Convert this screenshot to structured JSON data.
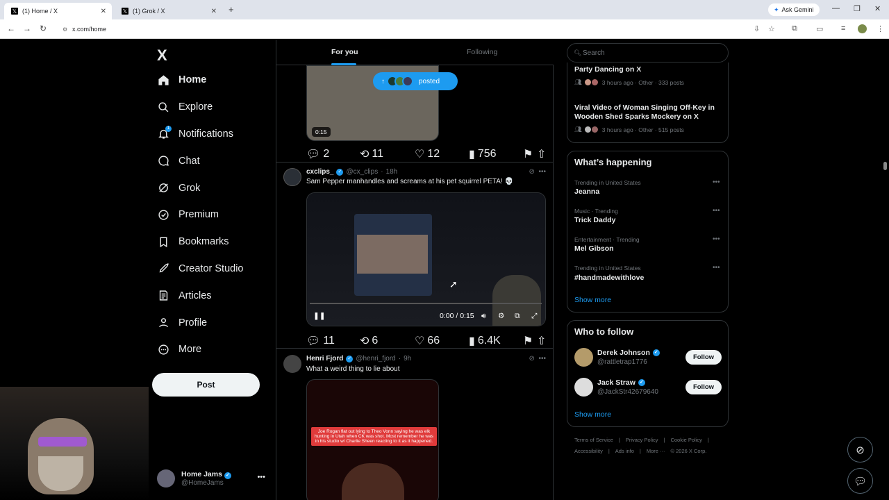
{
  "browser": {
    "tabs": [
      {
        "title": "(1) Home / X",
        "active": true
      },
      {
        "title": "(1) Grok / X",
        "active": false
      }
    ],
    "ask_gemini": "Ask Gemini",
    "url": "x.com/home"
  },
  "sidebar": {
    "logo": "X",
    "items": [
      {
        "label": "Home",
        "icon": "home-icon"
      },
      {
        "label": "Explore",
        "icon": "search-icon"
      },
      {
        "label": "Notifications",
        "icon": "bell-icon",
        "badge": "1"
      },
      {
        "label": "Chat",
        "icon": "chat-icon"
      },
      {
        "label": "Grok",
        "icon": "grok-icon"
      },
      {
        "label": "Premium",
        "icon": "premium-icon"
      },
      {
        "label": "Bookmarks",
        "icon": "bookmark-icon"
      },
      {
        "label": "Creator Studio",
        "icon": "rocket-icon"
      },
      {
        "label": "Articles",
        "icon": "article-icon"
      },
      {
        "label": "Profile",
        "icon": "profile-icon"
      },
      {
        "label": "More",
        "icon": "more-circle-icon"
      }
    ],
    "post_button": "Post",
    "account": {
      "name": "Home Jams",
      "handle": "@HomeJams"
    }
  },
  "feed": {
    "tabs": [
      "For you",
      "Following"
    ],
    "new_posts_pill": "posted",
    "posts": [
      {
        "media_time": "0:15",
        "replies": "2",
        "reposts": "11",
        "likes": "12",
        "views": "756"
      },
      {
        "name": "cxclips_",
        "handle": "@cx_clips",
        "time": "18h",
        "text": "Sam Pepper manhandles and screams at his pet squirrel  PETA! 💀",
        "video_time": "0:00 / 0:15",
        "replies": "11",
        "reposts": "6",
        "likes": "66",
        "views": "6.4K"
      },
      {
        "name": "Henri Fjord",
        "handle": "@henri_fjord",
        "time": "9h",
        "text": "What a weird thing to lie about",
        "media_caption": "Joe Rogan flat out lying to Theo Vonn saying he was elk hunting in Utah when CK was shot. Most remember he was in his studio w/ Charlie Sheen reacting to it as it happened."
      }
    ]
  },
  "right": {
    "search_placeholder": "Search",
    "news": [
      {
        "title": "Party Dancing on X",
        "meta": "3 hours ago · Other · 333 posts"
      },
      {
        "title": "Viral Video of Woman Singing Off-Key in Wooden Shed Sparks Mockery on X",
        "meta": "3 hours ago · Other · 515 posts"
      }
    ],
    "whats_happening_title": "What’s happening",
    "trends": [
      {
        "category": "Trending in United States",
        "name": "Jeanna"
      },
      {
        "category": "Music · Trending",
        "name": "Trick Daddy"
      },
      {
        "category": "Entertainment · Trending",
        "name": "Mel Gibson"
      },
      {
        "category": "Trending in United States",
        "name": "#handmadewithlove"
      }
    ],
    "show_more": "Show more",
    "who_to_follow_title": "Who to follow",
    "follow_suggestions": [
      {
        "name": "Derek Johnson",
        "handle": "@rattletrap1776",
        "button": "Follow"
      },
      {
        "name": "Jack Straw",
        "handle": "@JackStr42679640",
        "button": "Follow"
      }
    ],
    "footer_row1": [
      "Terms of Service",
      "Privacy Policy",
      "Cookie Policy"
    ],
    "footer_row2": [
      "Accessibility",
      "Ads info",
      "More ···",
      "© 2026 X Corp."
    ]
  },
  "colors": {
    "accent": "#1d9bf0",
    "background": "#000000",
    "muted": "#71767b"
  }
}
